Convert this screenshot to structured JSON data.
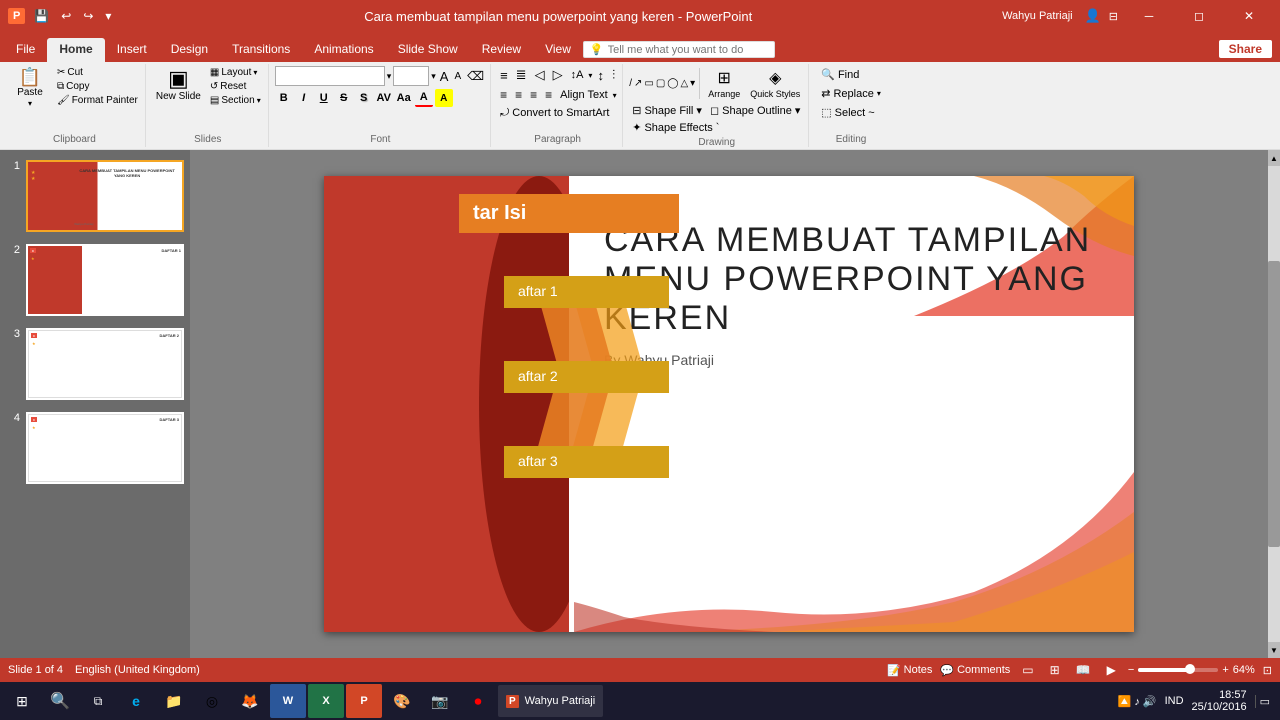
{
  "titlebar": {
    "title": "Cara membuat tampilan menu powerpoint yang keren - PowerPoint",
    "user": "Wahyu Patriaji",
    "quickaccess": [
      "save",
      "undo",
      "redo",
      "customize"
    ]
  },
  "ribbon": {
    "tabs": [
      "File",
      "Home",
      "Insert",
      "Design",
      "Transitions",
      "Animations",
      "Slide Show",
      "Review",
      "View"
    ],
    "active_tab": "Home",
    "search_placeholder": "Tell me what you want to do",
    "share_label": "Share",
    "groups": {
      "clipboard": {
        "label": "Clipboard",
        "paste_label": "Paste",
        "cut_label": "Cut",
        "copy_label": "Copy",
        "format_painter_label": "Format Painter"
      },
      "slides": {
        "label": "Slides",
        "new_slide_label": "New Slide",
        "layout_label": "Layout",
        "reset_label": "Reset",
        "section_label": "Section"
      },
      "font": {
        "label": "Font",
        "font_name": "",
        "font_size": "",
        "bold": "B",
        "italic": "I",
        "underline": "U",
        "strikethrough": "S",
        "font_color_label": "A",
        "highlight_label": "A"
      },
      "paragraph": {
        "label": "Paragraph",
        "text_direction_label": "Text Direction",
        "align_text_label": "Align Text",
        "convert_smartart_label": "Convert to SmartArt"
      },
      "drawing": {
        "label": "Drawing",
        "arrange_label": "Arrange",
        "quick_styles_label": "Quick Styles",
        "shape_fill_label": "Shape Fill",
        "shape_outline_label": "Shape Outline",
        "shape_effects_label": "Shape Effects `"
      },
      "editing": {
        "label": "Editing",
        "find_label": "Find",
        "replace_label": "Replace",
        "select_label": "Select ~"
      }
    }
  },
  "slides": [
    {
      "num": "1",
      "active": true,
      "title": "DAFTAR ISI"
    },
    {
      "num": "2",
      "active": false,
      "title": "DAFTAR 1"
    },
    {
      "num": "3",
      "active": false,
      "title": "DAFTAR 2"
    },
    {
      "num": "4",
      "active": false,
      "title": "DAFTAR 3"
    }
  ],
  "slide_content": {
    "table_of_contents_title": "tar Isi",
    "item1": "aftar 1",
    "item2": "aftar 2",
    "item3": "aftar 3",
    "main_title_line1": "CARA MEMBUAT TAMPILAN",
    "main_title_line2": "MENU POWERPOINT YANG",
    "main_title_line3": "KEREN",
    "author": "By Wahyu Patriaji"
  },
  "statusbar": {
    "slide_info": "Slide 1 of 4",
    "language": "English (United Kingdom)",
    "notes_label": "Notes",
    "comments_label": "Comments",
    "zoom_level": "64%"
  },
  "taskbar": {
    "time": "18:57",
    "date": "25/10/2016",
    "language_indicator": "IND",
    "apps": [
      "Wahyu Patriaji"
    ]
  },
  "icons": {
    "save": "💾",
    "undo": "↩",
    "redo": "↪",
    "dropdown": "▾",
    "paste_icon": "📋",
    "cut": "✂",
    "copy": "⧉",
    "format_painter": "🖌",
    "new_slide": "▣",
    "bold": "B",
    "italic": "I",
    "underline": "U",
    "bullets": "≡",
    "numbering": "≣",
    "indent_dec": "◁",
    "indent_inc": "▷",
    "line_spacing": "↕",
    "find": "🔍",
    "replace": "⇄",
    "notes": "📝",
    "comments": "💬",
    "normal_view": "▭",
    "slide_sorter": "⊞",
    "reading_view": "📖",
    "slide_show": "▶",
    "zoom_out": "−",
    "zoom_in": "+",
    "windows": "⊞",
    "search": "🔍",
    "chrome": "◎",
    "firefox": "🦊",
    "word": "W",
    "excel": "X",
    "ppt": "P",
    "paint": "🎨",
    "camera": "📷",
    "record": "⏺"
  }
}
